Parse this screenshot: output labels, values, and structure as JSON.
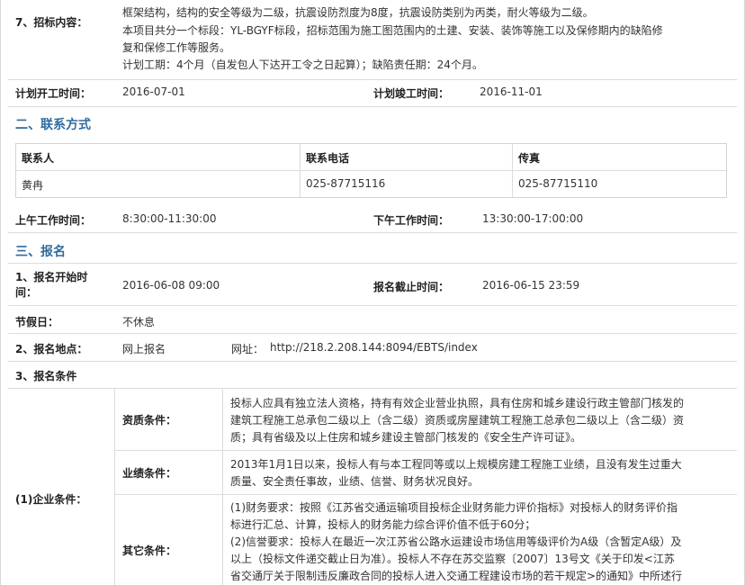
{
  "item7": {
    "label": "7、招标内容：",
    "lines": [
      "框架结构，结构的安全等级为二级，抗震设防烈度为8度，抗震设防类别为丙类，耐火等级为二级。",
      "本项目共分一个标段：YL-BGYF标段，招标范围为施工图范围内的土建、安装、装饰等施工以及保修期内的缺陷修",
      "复和保修工作等服务。",
      "计划工期：4个月（自发包人下达开工令之日起算）；缺陷责任期：24个月。"
    ]
  },
  "schedule": {
    "start_label": "计划开工时间：",
    "start_value": "2016-07-01",
    "end_label": "计划竣工时间：",
    "end_value": "2016-11-01"
  },
  "section2": {
    "title": "二、联系方式",
    "headers": [
      "联系人",
      "联系电话",
      "传真"
    ],
    "row": [
      "黄冉",
      "025-87715116",
      "025-87715110"
    ]
  },
  "hours": {
    "am_label": "上午工作时间：",
    "am_value": "8:30:00-11:30:00",
    "pm_label": "下午工作时间：",
    "pm_value": "13:30:00-17:00:00"
  },
  "section3": {
    "title": "三、报名",
    "start_label": "1、报名开始时间：",
    "start_value": "2016-06-08 09:00",
    "end_label": "报名截止时间：",
    "end_value": "2016-06-15 23:59",
    "holiday_label": "节假日：",
    "holiday_value": "不休息",
    "place_label": "2、报名地点：",
    "place_value": "网上报名",
    "url_label": "网址：",
    "url_value": "http://218.2.208.144:8094/EBTS/index",
    "cond_label": "3、报名条件"
  },
  "enterprise": {
    "label": "(1)企业条件：",
    "qual_label": "资质条件：",
    "qual_lines": [
      "投标人应具有独立法人资格，持有有效企业营业执照，具有住房和城乡建设行政主管部门核发的",
      "建筑工程施工总承包二级以上（含二级）资质或房屋建筑工程施工总承包二级以上（含二级）资",
      "质；具有省级及以上住房和城乡建设主管部门核发的《安全生产许可证》。"
    ],
    "perf_label": "业绩条件：",
    "perf_lines": [
      "2013年1月1日以来，投标人有与本工程同等或以上规模房建工程施工业绩，且没有发生过重大",
      "质量、安全责任事故，业绩、信誉、财务状况良好。"
    ],
    "other_label": "其它条件：",
    "other_lines": [
      "(1)财务要求：按照《江苏省交通运输项目投标企业财务能力评价指标》对投标人的财务评价指",
      "标进行汇总、计算，投标人的财务能力综合评价值不低于60分；",
      "(2)信誉要求：投标人在最近一次江苏省公路水运建设市场信用等级评价为A级（含暂定A级）及",
      "以上（投标文件递交截止日为准）。投标人不存在苏交监察〔2007〕13号文《关于印发<江苏",
      "省交通厅关于限制违反廉政合同的投标人进入交通工程建设市场的若干规定>的通知》中所述行"
    ]
  }
}
